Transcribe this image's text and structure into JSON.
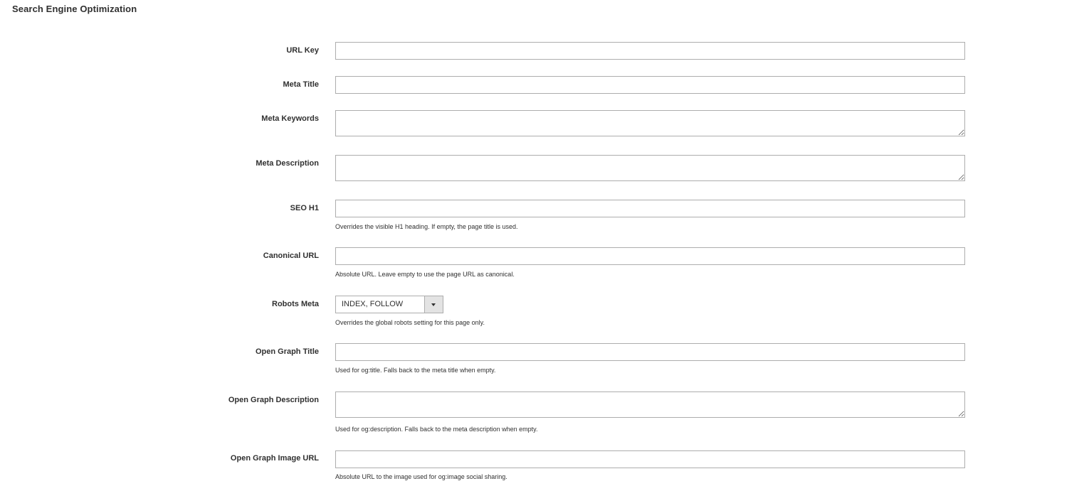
{
  "section": {
    "title": "Search Engine Optimization"
  },
  "fields": {
    "url_key": {
      "label": "URL Key",
      "value": ""
    },
    "meta_title": {
      "label": "Meta Title",
      "value": ""
    },
    "meta_keywords": {
      "label": "Meta Keywords",
      "value": ""
    },
    "meta_description": {
      "label": "Meta Description",
      "value": ""
    },
    "seo_h1": {
      "label": "SEO H1",
      "value": "",
      "note": "Overrides the visible H1 heading. If empty, the page title is used."
    },
    "canonical_url": {
      "label": "Canonical URL",
      "value": "",
      "note": "Absolute URL. Leave empty to use the page URL as canonical."
    },
    "robots_meta": {
      "label": "Robots Meta",
      "selected": "INDEX, FOLLOW",
      "icon": "chevron-down-icon",
      "note": "Overrides the global robots setting for this page only."
    },
    "og_title": {
      "label": "Open Graph Title",
      "value": "",
      "note": "Used for og:title. Falls back to the meta title when empty."
    },
    "og_description": {
      "label": "Open Graph Description",
      "value": "",
      "note": "Used for og:description. Falls back to the meta description when empty."
    },
    "og_image_url": {
      "label": "Open Graph Image URL",
      "value": "",
      "note": "Absolute URL to the image used for og:image social sharing."
    }
  }
}
